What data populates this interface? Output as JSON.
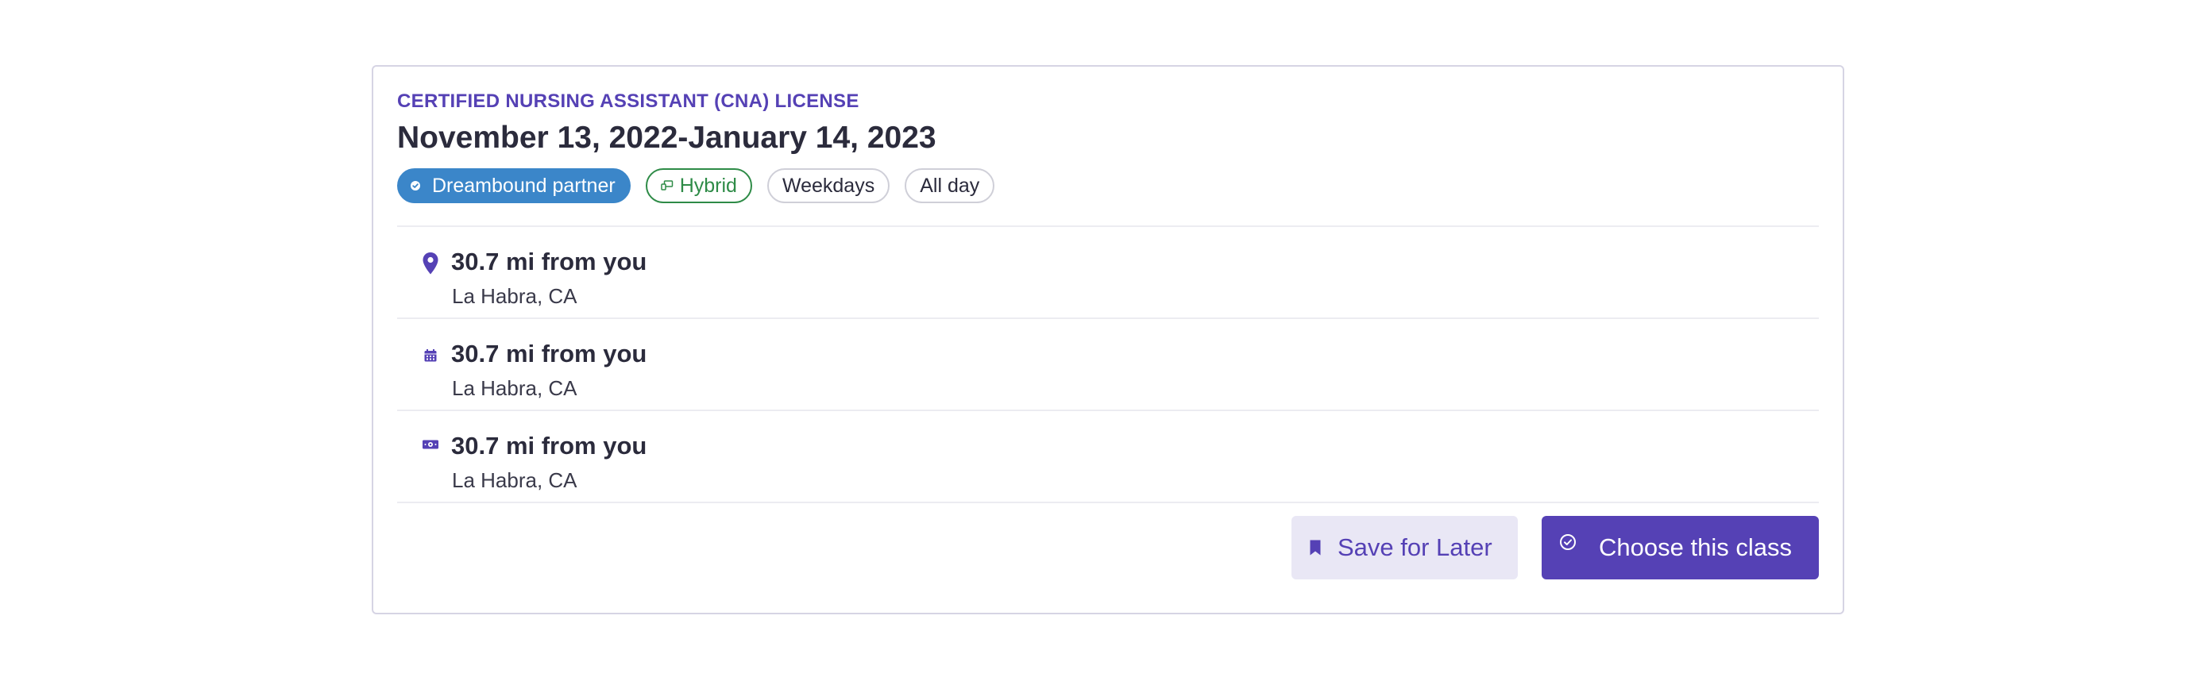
{
  "card": {
    "eyebrow": "CERTIFIED NURSING ASSISTANT (CNA) LICENSE",
    "title": "November 13, 2022-January 14, 2023",
    "tags": [
      {
        "label": "Dreambound partner",
        "icon": "badge-check-icon",
        "color": "#3b86c9"
      },
      {
        "label": "Hybrid",
        "icon": "hybrid-icon",
        "color": "#2e8b47"
      },
      {
        "label": "Weekdays"
      },
      {
        "label": "All day"
      }
    ],
    "details": [
      {
        "icon": "map-pin-icon",
        "main": "30.7 mi from you",
        "sub": "La Habra, CA"
      },
      {
        "icon": "calendar-icon",
        "main": "30.7 mi from you",
        "sub": "La Habra, CA"
      },
      {
        "icon": "money-icon",
        "main": "30.7 mi from you",
        "sub": "La Habra, CA"
      }
    ],
    "actions": {
      "save_label": "Save for Later",
      "save_icon": "bookmark-icon",
      "choose_label": "Choose this class",
      "choose_icon": "check-circle-icon"
    }
  },
  "colors": {
    "accent": "#5541b5",
    "partner": "#3b86c9",
    "hybrid": "#2e8b47",
    "border": "#d6d4e4"
  }
}
